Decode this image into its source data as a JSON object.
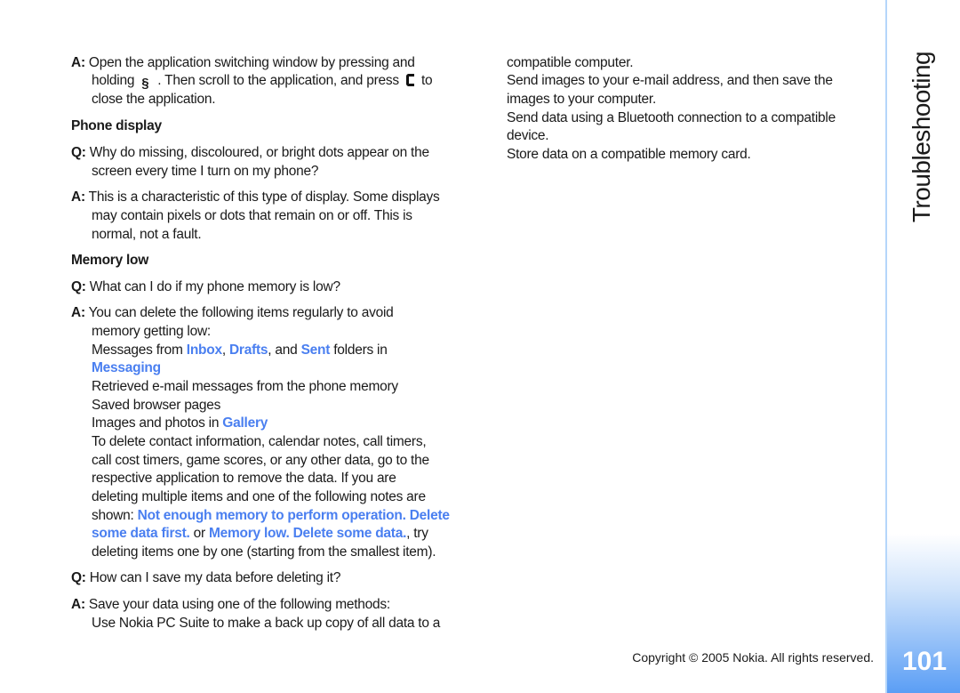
{
  "left": {
    "lines": [
      [
        {
          "t": "A:",
          "s": "b"
        },
        {
          "t": " Open the application switching window by pressing and"
        }
      ],
      [
        {
          "t": "holding "
        },
        {
          "icon": "menu-key-icon"
        },
        {
          "t": ". Then scroll to the application, and press "
        },
        {
          "icon": "clear-key-icon"
        },
        {
          "t": " to"
        }
      ],
      [
        {
          "t": "close the application."
        }
      ],
      [
        {
          "t": "Phone display",
          "s": "b"
        }
      ],
      [
        {
          "t": "Q:",
          "s": "b"
        },
        {
          "t": " Why do missing, discoloured, or bright dots appear on the"
        }
      ],
      [
        {
          "t": "screen every time I turn on my phone?"
        }
      ],
      [
        {
          "t": "A:",
          "s": "b"
        },
        {
          "t": " This is a characteristic of this type of display. Some displays"
        }
      ],
      [
        {
          "t": "may contain pixels or dots that remain on or off. This is"
        }
      ],
      [
        {
          "t": "normal, not a fault."
        }
      ],
      [
        {
          "t": "Memory low",
          "s": "b"
        }
      ],
      [
        {
          "t": "Q:",
          "s": "b"
        },
        {
          "t": " What can I do if my phone memory is low?"
        }
      ],
      [
        {
          "t": "A:",
          "s": "b"
        },
        {
          "t": " You can delete the following items regularly to avoid"
        }
      ],
      [
        {
          "t": "memory getting low:"
        }
      ],
      [
        {
          "t": "Messages from "
        },
        {
          "t": "Inbox",
          "s": "link"
        },
        {
          "t": ", "
        },
        {
          "t": "Drafts",
          "s": "link"
        },
        {
          "t": ", and "
        },
        {
          "t": "Sent",
          "s": "link"
        },
        {
          "t": " folders in"
        }
      ],
      [
        {
          "t": "Messaging",
          "s": "link"
        }
      ],
      [
        {
          "t": "Retrieved e-mail messages from the phone memory"
        }
      ],
      [
        {
          "t": "Saved browser pages"
        }
      ],
      [
        {
          "t": "Images and photos in "
        },
        {
          "t": "Gallery",
          "s": "link"
        }
      ],
      [
        {
          "t": "To delete contact information, calendar notes, call timers,"
        }
      ],
      [
        {
          "t": "call cost timers, game scores, or any other data, go to the"
        }
      ],
      [
        {
          "t": "respective application to remove the data. If you are"
        }
      ],
      [
        {
          "t": "deleting multiple items and one of the following notes are"
        }
      ],
      [
        {
          "t": "shown: "
        },
        {
          "t": "Not enough memory to perform operation. Delete",
          "s": "link"
        }
      ],
      [
        {
          "t": "some data first.",
          "s": "link"
        },
        {
          "t": " or "
        },
        {
          "t": "Memory low. Delete some data.",
          "s": "link"
        },
        {
          "t": ", try"
        }
      ],
      [
        {
          "t": "deleting items one by one (starting from the smallest item)."
        }
      ],
      [
        {
          "t": "Q:",
          "s": "b"
        },
        {
          "t": " How can I save my data before deleting it?"
        }
      ],
      [
        {
          "t": "A:",
          "s": "b"
        },
        {
          "t": " Save your data using one of the following methods:"
        }
      ],
      [
        {
          "t": "Use Nokia PC Suite to make a back up copy of all data to a"
        }
      ]
    ]
  },
  "right": {
    "lines": [
      [
        {
          "t": "compatible computer."
        }
      ],
      [
        {
          "t": "Send images to your e-mail address, and then save the"
        }
      ],
      [
        {
          "t": "images to your computer."
        }
      ],
      [
        {
          "t": "Send data using a Bluetooth connection to a compatible"
        }
      ],
      [
        {
          "t": "device."
        }
      ],
      [
        {
          "t": "Store data on a compatible memory card."
        }
      ]
    ]
  },
  "sidebar": {
    "section_title": "Troubleshooting",
    "page_number": "101"
  },
  "footer": {
    "copyright": "Copyright © 2005 Nokia. All rights reserved."
  },
  "colors": {
    "link": "#4a7ff0",
    "sidebar_accent": "#5b9ef5"
  }
}
